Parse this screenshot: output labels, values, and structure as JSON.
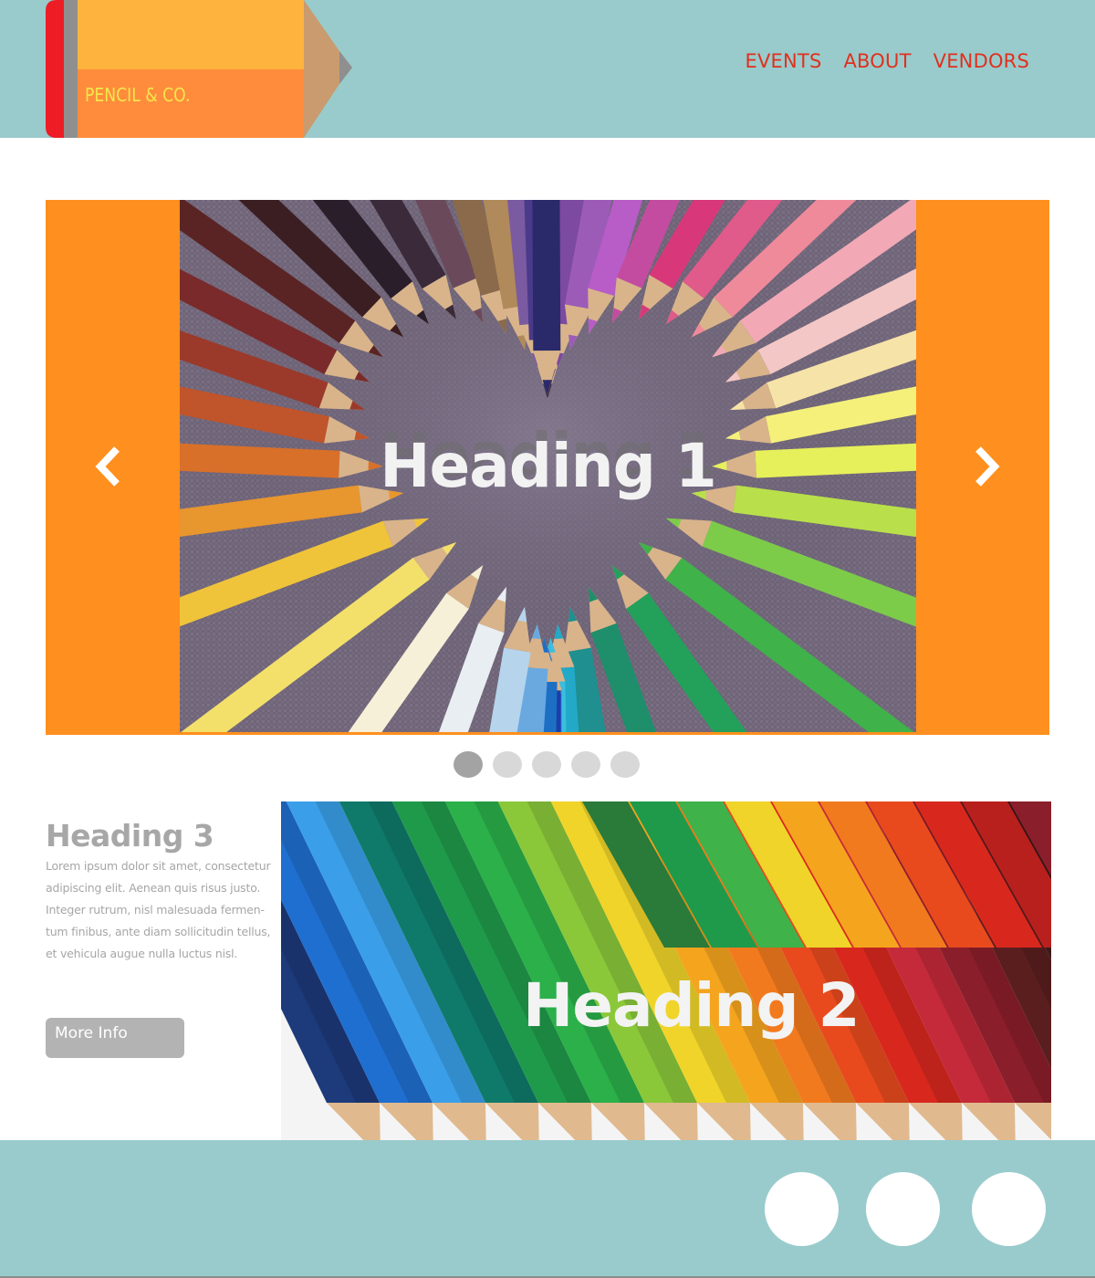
{
  "brand": {
    "name": "PENCIL & CO."
  },
  "nav": {
    "items": [
      "EVENTS",
      "ABOUT",
      "VENDORS"
    ]
  },
  "carousel": {
    "slide_heading": "Heading 1",
    "image": "colored-pencils-heart-photo",
    "prev_icon": "chevron-left-icon",
    "next_icon": "chevron-right-icon",
    "indicator_count": 5,
    "active_indicator": 0
  },
  "feature": {
    "heading": "Heading 3",
    "body": "Lorem ipsum dolor sit amet, consectetur adipiscing elit. Aenean quis risus justo. Integer rutrum, nisl malesuada fermen-tum finibus, ante diam sollicitudin tellus, et vehicula augue nulla luctus nisl.",
    "button_label": "More Info",
    "image": "colored-pencils-rows-photo",
    "image_heading": "Heading 2"
  },
  "footer": {
    "social_icons": [
      "social-icon-1",
      "social-icon-2",
      "social-icon-3"
    ]
  },
  "colors": {
    "header_bg": "#99cbcc",
    "nav_text": "#e0301e",
    "carousel_bg": "#ff8f1e",
    "logo_text": "#f4e64c",
    "muted_text": "#a7a7a7",
    "button_bg": "#b3b3b3"
  }
}
